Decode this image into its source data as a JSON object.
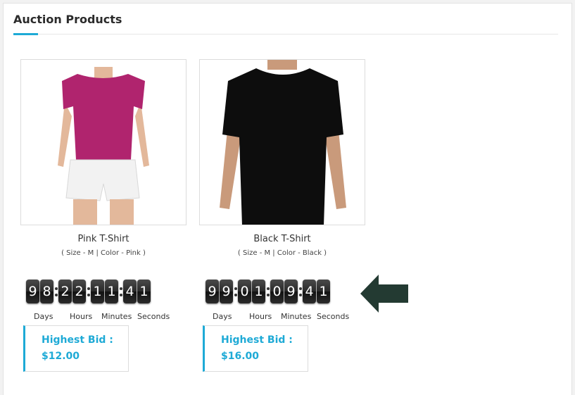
{
  "section": {
    "title": "Auction Products"
  },
  "products": [
    {
      "name": "Pink T-Shirt",
      "attributes": "( Size - M | Color - Pink )",
      "countdown": {
        "days": [
          "9",
          "8"
        ],
        "hours": [
          "2",
          "2"
        ],
        "minutes": [
          "1",
          "1"
        ],
        "seconds": [
          "4",
          "1"
        ]
      },
      "bid_label": "Highest Bid :",
      "bid_value": "$12.00",
      "shirt_color": "#b0246e"
    },
    {
      "name": "Black T-Shirt",
      "attributes": "( Size - M | Color - Black )",
      "countdown": {
        "days": [
          "9",
          "9"
        ],
        "hours": [
          "0",
          "1"
        ],
        "minutes": [
          "0",
          "9"
        ],
        "seconds": [
          "4",
          "1"
        ]
      },
      "bid_label": "Highest Bid :",
      "bid_value": "$16.00",
      "shirt_color": "#0d0d0d"
    }
  ],
  "countdown_labels": {
    "days": "Days",
    "hours": "Hours",
    "minutes": "Minutes",
    "seconds": "Seconds"
  },
  "accent_color": "#1eaad6",
  "annotation_arrow": "left-pointing-arrow-icon"
}
